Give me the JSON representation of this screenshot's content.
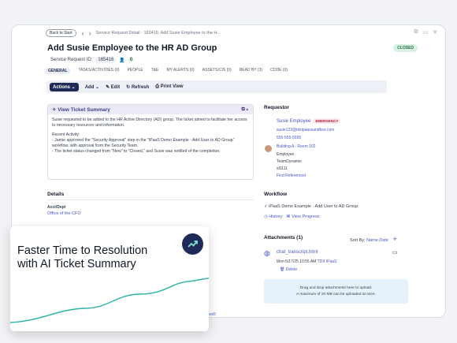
{
  "topbar": {
    "back_label": "Back to Start",
    "breadcrumb": "Service Request Detail - 165416: Add Susie Employee to the H..."
  },
  "title": "Add Susie Employee to the HR AD Group",
  "status": "CLOSED",
  "service_request": {
    "label": "Service Request ID:",
    "id": "165416",
    "count": "0"
  },
  "tabs": [
    "GENERAL",
    "TASKS/ACTIVITIES (0)",
    "PEOPLE",
    "T&E",
    "MY ALERTS (0)",
    "ASSETS/CIS (0)",
    "READ BY (3)",
    "CODE (0)"
  ],
  "toolbar": {
    "actions": "Actions",
    "add": "Add",
    "edit": "Edit",
    "refresh": "Refresh",
    "print": "Print View"
  },
  "summary": {
    "header": "View Ticket Summary",
    "para1": "Susie requested to be added to the HR Active Directory (AD) group. The ticket aimed to facilitate her access to necessary resources and information.",
    "recent": "Recent Activity:",
    "line1": "- Jamie approved the \"Security Approval\" step in the \"iPaaS Demo Example - Add User to AD Group\" workflow, with approval from the Security Team.",
    "line2": "- The ticket status changed from \"New\" to \"Closed,\" and Susie was notified of the completion."
  },
  "details": {
    "heading": "Details",
    "acct_label": "Acct/Dept",
    "acct_value": "Office of the CFO"
  },
  "requestor": {
    "heading": "Requestor",
    "name": "Susie Employee",
    "badge": "EMERGENCY",
    "email": "susie123@tdxipaassandbox.com",
    "phone": "555-555-5555",
    "location": "Building A - Room 102",
    "role": "Employee",
    "org": "TeamDynamix",
    "code": "sf1111",
    "find": "Find Referenced"
  },
  "workflow": {
    "heading": "Workflow",
    "name": "iPaaS Demo Example - Add User to AD Group",
    "history": "History",
    "progress": "View Progress"
  },
  "attachments": {
    "heading": "Attachments (1)",
    "sort_label": "Sort By:",
    "sort_value": "Name",
    "sort_dir": "Date",
    "file": "chat_transcript.html",
    "meta": "Mon 5/17/25 10:55 AM",
    "by": "TDX iPaaS",
    "delete": "Delete",
    "drop1": "Drag and drop attachments here to upload.",
    "drop2": "A maximum of 20 MB can be uploaded at once."
  },
  "overlay": {
    "line1": "Faster Time to Resolution",
    "line2": "with AI Ticket Summary",
    "peek": "ws5"
  },
  "colors": {
    "navy": "#1f2a55",
    "link": "#4657c6",
    "accent": "#3b3f8a",
    "closed": "#1f6b3d",
    "emergency": "#b4233e",
    "wave": "#2fb5a8"
  }
}
